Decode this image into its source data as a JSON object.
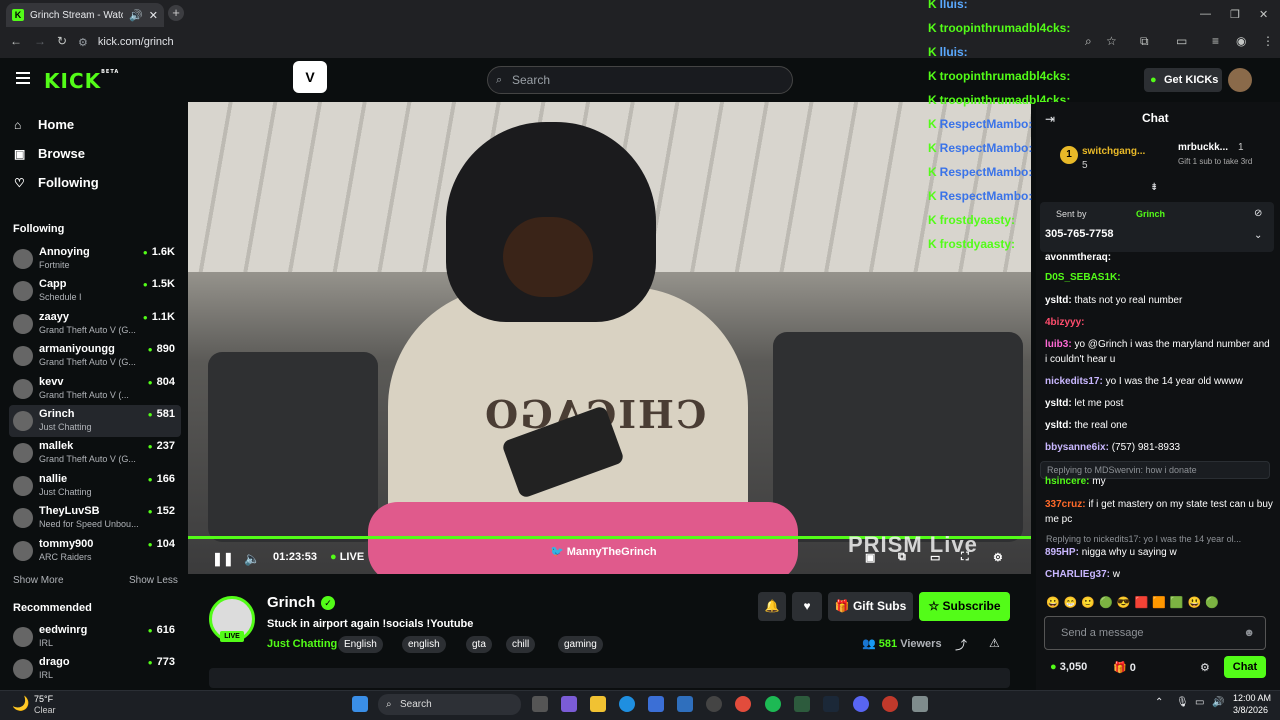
{
  "browser": {
    "tab_title": "Grinch Stream - Watch Live",
    "url": "kick.com/grinch",
    "new_tab": "+",
    "close": "✕"
  },
  "header": {
    "logo": "KICK",
    "logo_sup": "BETA",
    "search_placeholder": "Search",
    "get_kicks": "Get KICKs",
    "chat_title": "Chat"
  },
  "sidebar": {
    "nav": [
      {
        "label": "Home",
        "icon": "home-icon"
      },
      {
        "label": "Browse",
        "icon": "browse-icon"
      },
      {
        "label": "Following",
        "icon": "heart-icon"
      }
    ],
    "following_title": "Following",
    "following": [
      {
        "name": "Annoying",
        "category": "Fortnite",
        "viewers": "1.6K"
      },
      {
        "name": "Capp",
        "category": "Schedule I",
        "viewers": "1.5K"
      },
      {
        "name": "zaayy",
        "category": "Grand Theft Auto V (G...",
        "viewers": "1.1K"
      },
      {
        "name": "armaniyoungg",
        "category": "Grand Theft Auto V (G...",
        "viewers": "890"
      },
      {
        "name": "kevv",
        "category": "Grand Theft Auto V (...",
        "viewers": "804"
      },
      {
        "name": "Grinch",
        "category": "Just Chatting",
        "viewers": "581"
      },
      {
        "name": "mallek",
        "category": "Grand Theft Auto V (G...",
        "viewers": "237"
      },
      {
        "name": "nallie",
        "category": "Just Chatting",
        "viewers": "166"
      },
      {
        "name": "TheyLuvSB",
        "category": "Need for Speed Unbou...",
        "viewers": "152"
      },
      {
        "name": "tommy900",
        "category": "ARC Raiders",
        "viewers": "104"
      }
    ],
    "show_more": "Show More",
    "show_less": "Show Less",
    "recommended_title": "Recommended",
    "recommended": [
      {
        "name": "eedwinrg",
        "category": "IRL",
        "viewers": "616"
      },
      {
        "name": "drago",
        "category": "IRL",
        "viewers": "773"
      }
    ]
  },
  "video": {
    "time": "01:23:53",
    "live": "LIVE",
    "twitter": "MannyTheGrinch",
    "watermark": "PRISM Live",
    "shirt": "CHICAGO"
  },
  "overlay_chat": [
    {
      "user": "lluis:",
      "color": "#5aa9ff"
    },
    {
      "user": "troopinthrumadbl4cks:",
      "color": "#53fc18"
    },
    {
      "user": "lluis:",
      "color": "#5aa9ff"
    },
    {
      "user": "troopinthrumadbl4cks:",
      "color": "#53fc18"
    },
    {
      "user": "troopinthrumadbl4cks:",
      "color": "#53fc18"
    },
    {
      "user": "RespectMambo:",
      "color": "#3a73e8"
    },
    {
      "user": "RespectMambo:",
      "color": "#3a73e8"
    },
    {
      "user": "RespectMambo:",
      "color": "#3a73e8"
    },
    {
      "user": "RespectMambo:",
      "color": "#3a73e8"
    },
    {
      "user": "frostdyaasty:",
      "color": "#53fc18"
    },
    {
      "user": "frostdyaasty:",
      "color": "#53fc18"
    }
  ],
  "stream": {
    "streamer": "Grinch",
    "title": "Stuck in airport again   !socials !Youtube",
    "category": "Just Chatting",
    "tags": [
      "English",
      "english",
      "gta",
      "chill",
      "gaming"
    ],
    "gift_subs": "Gift Subs",
    "subscribe": "Subscribe",
    "viewers_count": "581",
    "viewers_label": "Viewers",
    "live_badge": "LIVE"
  },
  "chat": {
    "leader1_name": "switchgang...",
    "leader1_count": "5",
    "leader2_name": "mrbuckk...",
    "leader2_count": "1",
    "leader2_sub": "Gift 1 sub to take 3rd",
    "pin_sent_by": "Sent by",
    "pin_author": "Grinch",
    "pin_text": "305-765-7758",
    "messages": [
      {
        "user": "avonmtheraq:",
        "text": "",
        "color": "#ffffff"
      },
      {
        "user": "D0S_SEBAS1K:",
        "text": "",
        "color": "#53fc18"
      },
      {
        "user": "ysltd:",
        "text": "thats not yo real number",
        "color": "#ffffff"
      },
      {
        "user": "4bizyyy:",
        "text": "",
        "color": "#ff4d6d"
      },
      {
        "user": "luib3:",
        "text": "yo @Grinch i was the maryland number and i couldn't hear u",
        "color": "#ff6ad5"
      },
      {
        "user": "nickedits17:",
        "text": "yo I was the 14 year old wwww",
        "color": "#c9b7ff"
      },
      {
        "user": "ysltd:",
        "text": "let me post",
        "color": "#ffffff"
      },
      {
        "user": "ysltd:",
        "text": "the real one",
        "color": "#ffffff"
      },
      {
        "user": "bbysanne6ix:",
        "text": "(757) 981-8933",
        "color": "#c9b7ff"
      }
    ],
    "reply1": "Replying to MDSwervin: how i donate",
    "reply1_user": "hsincere:",
    "reply1_text": "my",
    "msg_337": {
      "user": "337cruz:",
      "text": "if i get mastery on my state test can u buy me pc"
    },
    "reply2": "Replying to nickedits17: yo I was the 14 year ol...",
    "reply2_user": "895HP:",
    "reply2_text": "nigga why u saying w",
    "last_user": "CHARLIEg37:",
    "last_text": "w",
    "input_placeholder": "Send a message",
    "kicks_balance": "3,050",
    "gift_count": "0",
    "send": "Chat"
  },
  "taskbar": {
    "weather_temp": "75°F",
    "weather_desc": "Clear",
    "search": "Search",
    "time": "12:00 AM",
    "date": "3/8/2026"
  },
  "colors": {
    "accent": "#53fc18",
    "bg": "#0b0e0f"
  }
}
